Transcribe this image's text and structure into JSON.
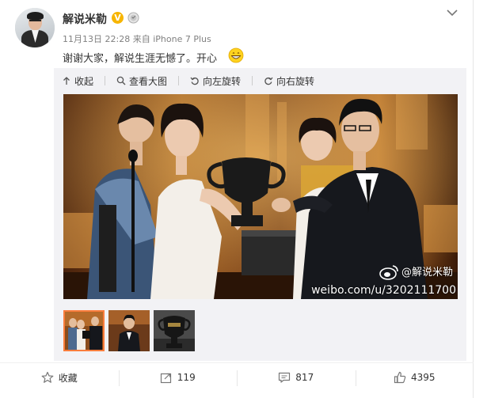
{
  "post": {
    "username": "解说米勒",
    "verified_badge": "V",
    "time": "11月13日 22:28",
    "from_label": "来自",
    "source": "iPhone 7 Plus",
    "text": "谢谢大家，解说生涯无憾了。开心",
    "emoji": "grin-emoji"
  },
  "media": {
    "toolbar": [
      {
        "icon": "collapse-icon",
        "label": "收起"
      },
      {
        "icon": "zoom-icon",
        "label": "查看大图"
      },
      {
        "icon": "rotate-left-icon",
        "label": "向左旋转"
      },
      {
        "icon": "rotate-right-icon",
        "label": "向右旋转"
      }
    ],
    "watermark_handle": "@解说米勒",
    "watermark_url": "weibo.com/u/3202111700",
    "thumbnail_count": 3,
    "selected_thumbnail": 1
  },
  "actions": [
    {
      "icon": "favorite-icon",
      "label": "收藏"
    },
    {
      "icon": "repost-icon",
      "label": "119"
    },
    {
      "icon": "comment-icon",
      "label": "817"
    },
    {
      "icon": "like-icon",
      "label": "4395"
    }
  ],
  "colors": {
    "accent": "#fa7d3c",
    "badge": "#f7b500",
    "link": "#eb7350",
    "muted": "#808080"
  }
}
